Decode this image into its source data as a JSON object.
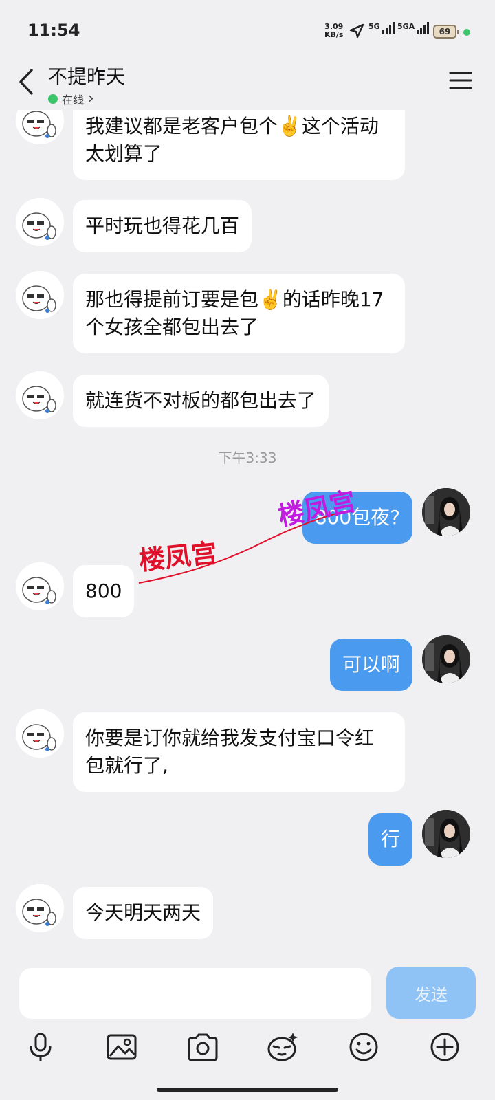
{
  "status": {
    "time": "11:54",
    "net_speed_value": "3.09",
    "net_speed_unit": "KB/s",
    "sim1": "5G",
    "sim2": "5GA",
    "battery": "69"
  },
  "header": {
    "title": "不提昨天",
    "status": "在线",
    "status_chevron": "›",
    "back_icon": "chevron-left-icon",
    "menu_icon": "hamburger-menu-icon"
  },
  "messages": [
    {
      "side": "in",
      "text": "我建议都是老客户包个✌️这个活动太划算了"
    },
    {
      "side": "in",
      "text": "平时玩也得花几百"
    },
    {
      "side": "in",
      "text": "那也得提前订要是包✌️的话昨晚17个女孩全都包出去了"
    },
    {
      "side": "in",
      "text": "就连货不对板的都包出去了"
    },
    {
      "side": "time",
      "text": "下午3:33"
    },
    {
      "side": "out",
      "text": "800包夜?"
    },
    {
      "side": "in",
      "text": "800"
    },
    {
      "side": "out",
      "text": "可以啊"
    },
    {
      "side": "in",
      "text": "你要是订你就给我发支付宝口令红包就行了,"
    },
    {
      "side": "out",
      "text": "行"
    },
    {
      "side": "in",
      "text": "今天明天两天"
    }
  ],
  "watermark": {
    "text": "楼凤宫",
    "color1": "#e0102a",
    "color2": "#c21be0"
  },
  "input": {
    "placeholder": "",
    "send_label": "发送",
    "tools": [
      "microphone-icon",
      "image-icon",
      "camera-icon",
      "sticker-icon",
      "emoji-icon",
      "plus-icon"
    ]
  },
  "colors": {
    "background": "#f0f0f3",
    "incoming_bubble": "#ffffff",
    "outgoing_bubble": "#4a9bf0",
    "send_button_disabled": "#8fc2f5",
    "online_dot": "#3cc46a"
  }
}
